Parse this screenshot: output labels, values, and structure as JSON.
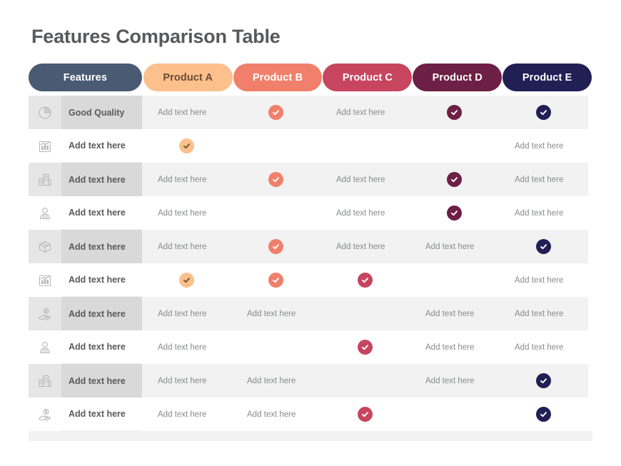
{
  "page": {
    "title": "Features Comparison Table"
  },
  "colors": {
    "features_pill_bg": "#4a5a73",
    "features_pill_text": "#ffffff",
    "product_a_bg": "#fcc08d",
    "product_a_text": "#6b4a33",
    "product_b_bg": "#f0806b",
    "product_b_text": "#ffffff",
    "product_c_bg": "#c8455f",
    "product_c_text": "#ffffff",
    "product_d_bg": "#6e1f45",
    "product_d_text": "#ffffff",
    "product_e_bg": "#221f55",
    "product_e_text": "#ffffff",
    "row_shade": "#f2f2f2",
    "row_plain": "#ffffff",
    "label_shade": "#d9d9d9",
    "icon_shade": "#e6e6e6",
    "title_text": "#58595b",
    "cell_text": "#888a8c",
    "label_text": "#595a5c",
    "check_a_glyph": "#7a5230",
    "check_other_glyph": "#ffffff"
  },
  "header": {
    "columns": [
      {
        "label": "Features",
        "key": "features"
      },
      {
        "label": "Product A",
        "key": "a"
      },
      {
        "label": "Product B",
        "key": "b"
      },
      {
        "label": "Product C",
        "key": "c"
      },
      {
        "label": "Product D",
        "key": "d"
      },
      {
        "label": "Product E",
        "key": "e"
      }
    ]
  },
  "placeholder_text": "Add text here",
  "rows": [
    {
      "icon": "pie-chart-icon",
      "label": "Good Quality",
      "shaded": true,
      "cells": [
        {
          "type": "text",
          "value": "Add text here"
        },
        {
          "type": "check",
          "color": "#f0806b"
        },
        {
          "type": "text",
          "value": "Add text here"
        },
        {
          "type": "check",
          "color": "#6e1f45"
        },
        {
          "type": "check",
          "color": "#221f55"
        }
      ]
    },
    {
      "icon": "bar-chart-icon",
      "label": "Add text here",
      "shaded": false,
      "cells": [
        {
          "type": "check",
          "color": "#fcc08d"
        },
        {
          "type": "empty"
        },
        {
          "type": "empty"
        },
        {
          "type": "empty"
        },
        {
          "type": "text",
          "value": "Add text here"
        }
      ]
    },
    {
      "icon": "buildings-icon",
      "label": "Add text here",
      "shaded": true,
      "cells": [
        {
          "type": "text",
          "value": "Add text here"
        },
        {
          "type": "check",
          "color": "#f0806b"
        },
        {
          "type": "text",
          "value": "Add text here"
        },
        {
          "type": "check",
          "color": "#6e1f45"
        },
        {
          "type": "text",
          "value": "Add text here"
        }
      ]
    },
    {
      "icon": "person-icon",
      "label": "Add text here",
      "shaded": false,
      "cells": [
        {
          "type": "text",
          "value": "Add text here"
        },
        {
          "type": "empty"
        },
        {
          "type": "text",
          "value": "Add text here"
        },
        {
          "type": "check",
          "color": "#6e1f45"
        },
        {
          "type": "text",
          "value": "Add text here"
        }
      ]
    },
    {
      "icon": "package-box-icon",
      "label": "Add text here",
      "shaded": true,
      "cells": [
        {
          "type": "text",
          "value": "Add text here"
        },
        {
          "type": "check",
          "color": "#f0806b"
        },
        {
          "type": "text",
          "value": "Add text here"
        },
        {
          "type": "text",
          "value": "Add text here"
        },
        {
          "type": "check",
          "color": "#221f55"
        }
      ]
    },
    {
      "icon": "bar-chart-icon",
      "label": "Add text here",
      "shaded": false,
      "cells": [
        {
          "type": "check",
          "color": "#fcc08d"
        },
        {
          "type": "check",
          "color": "#f0806b"
        },
        {
          "type": "check",
          "color": "#c8455f"
        },
        {
          "type": "empty"
        },
        {
          "type": "text",
          "value": "Add text here"
        }
      ]
    },
    {
      "icon": "hand-money-icon",
      "label": "Add text here",
      "shaded": true,
      "cells": [
        {
          "type": "text",
          "value": "Add text here"
        },
        {
          "type": "text",
          "value": "Add text here"
        },
        {
          "type": "empty"
        },
        {
          "type": "text",
          "value": "Add text here"
        },
        {
          "type": "text",
          "value": "Add text here"
        }
      ]
    },
    {
      "icon": "person-icon",
      "label": "Add text here",
      "shaded": false,
      "cells": [
        {
          "type": "text",
          "value": "Add text here"
        },
        {
          "type": "empty"
        },
        {
          "type": "check",
          "color": "#c8455f"
        },
        {
          "type": "text",
          "value": "Add text here"
        },
        {
          "type": "text",
          "value": "Add text here"
        }
      ]
    },
    {
      "icon": "buildings-icon",
      "label": "Add text here",
      "shaded": true,
      "cells": [
        {
          "type": "text",
          "value": "Add text here"
        },
        {
          "type": "text",
          "value": "Add text here"
        },
        {
          "type": "empty"
        },
        {
          "type": "text",
          "value": "Add text here"
        },
        {
          "type": "check",
          "color": "#221f55"
        }
      ]
    },
    {
      "icon": "hand-money-icon",
      "label": "Add text here",
      "shaded": false,
      "cells": [
        {
          "type": "text",
          "value": "Add text here"
        },
        {
          "type": "text",
          "value": "Add text here"
        },
        {
          "type": "check",
          "color": "#c8455f"
        },
        {
          "type": "empty"
        },
        {
          "type": "check",
          "color": "#221f55"
        }
      ]
    }
  ]
}
